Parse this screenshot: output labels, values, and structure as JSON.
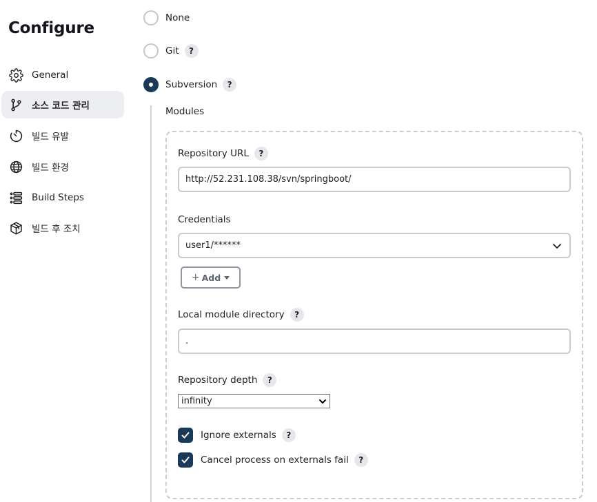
{
  "sidebar": {
    "title": "Configure",
    "items": [
      {
        "label": "General",
        "icon": "gear-icon"
      },
      {
        "label": "소스 코드 관리",
        "icon": "branch-icon"
      },
      {
        "label": "빌드 유발",
        "icon": "timer-icon"
      },
      {
        "label": "빌드 환경",
        "icon": "globe-icon"
      },
      {
        "label": "Build Steps",
        "icon": "list-icon"
      },
      {
        "label": "빌드 후 조치",
        "icon": "package-icon"
      }
    ]
  },
  "scm": {
    "options": [
      {
        "label": "None",
        "selected": false
      },
      {
        "label": "Git",
        "selected": false
      },
      {
        "label": "Subversion",
        "selected": true
      }
    ],
    "help_glyph": "?",
    "modules_label": "Modules",
    "repository_url_label": "Repository URL",
    "repository_url_value": "http://52.231.108.38/svn/springboot/",
    "credentials_label": "Credentials",
    "credentials_value": "user1/******",
    "add_button_label": "Add",
    "add_button_plus": "+",
    "local_module_directory_label": "Local module directory",
    "local_module_directory_value": ".",
    "repository_depth_label": "Repository depth",
    "repository_depth_value": "infinity",
    "ignore_externals_label": "Ignore externals",
    "ignore_externals_checked": true,
    "cancel_process_label": "Cancel process on externals fail",
    "cancel_process_checked": true
  },
  "colors": {
    "accent": "#1b3a57",
    "active_nav_bg": "#eceef1",
    "border": "#c8cbd0"
  }
}
